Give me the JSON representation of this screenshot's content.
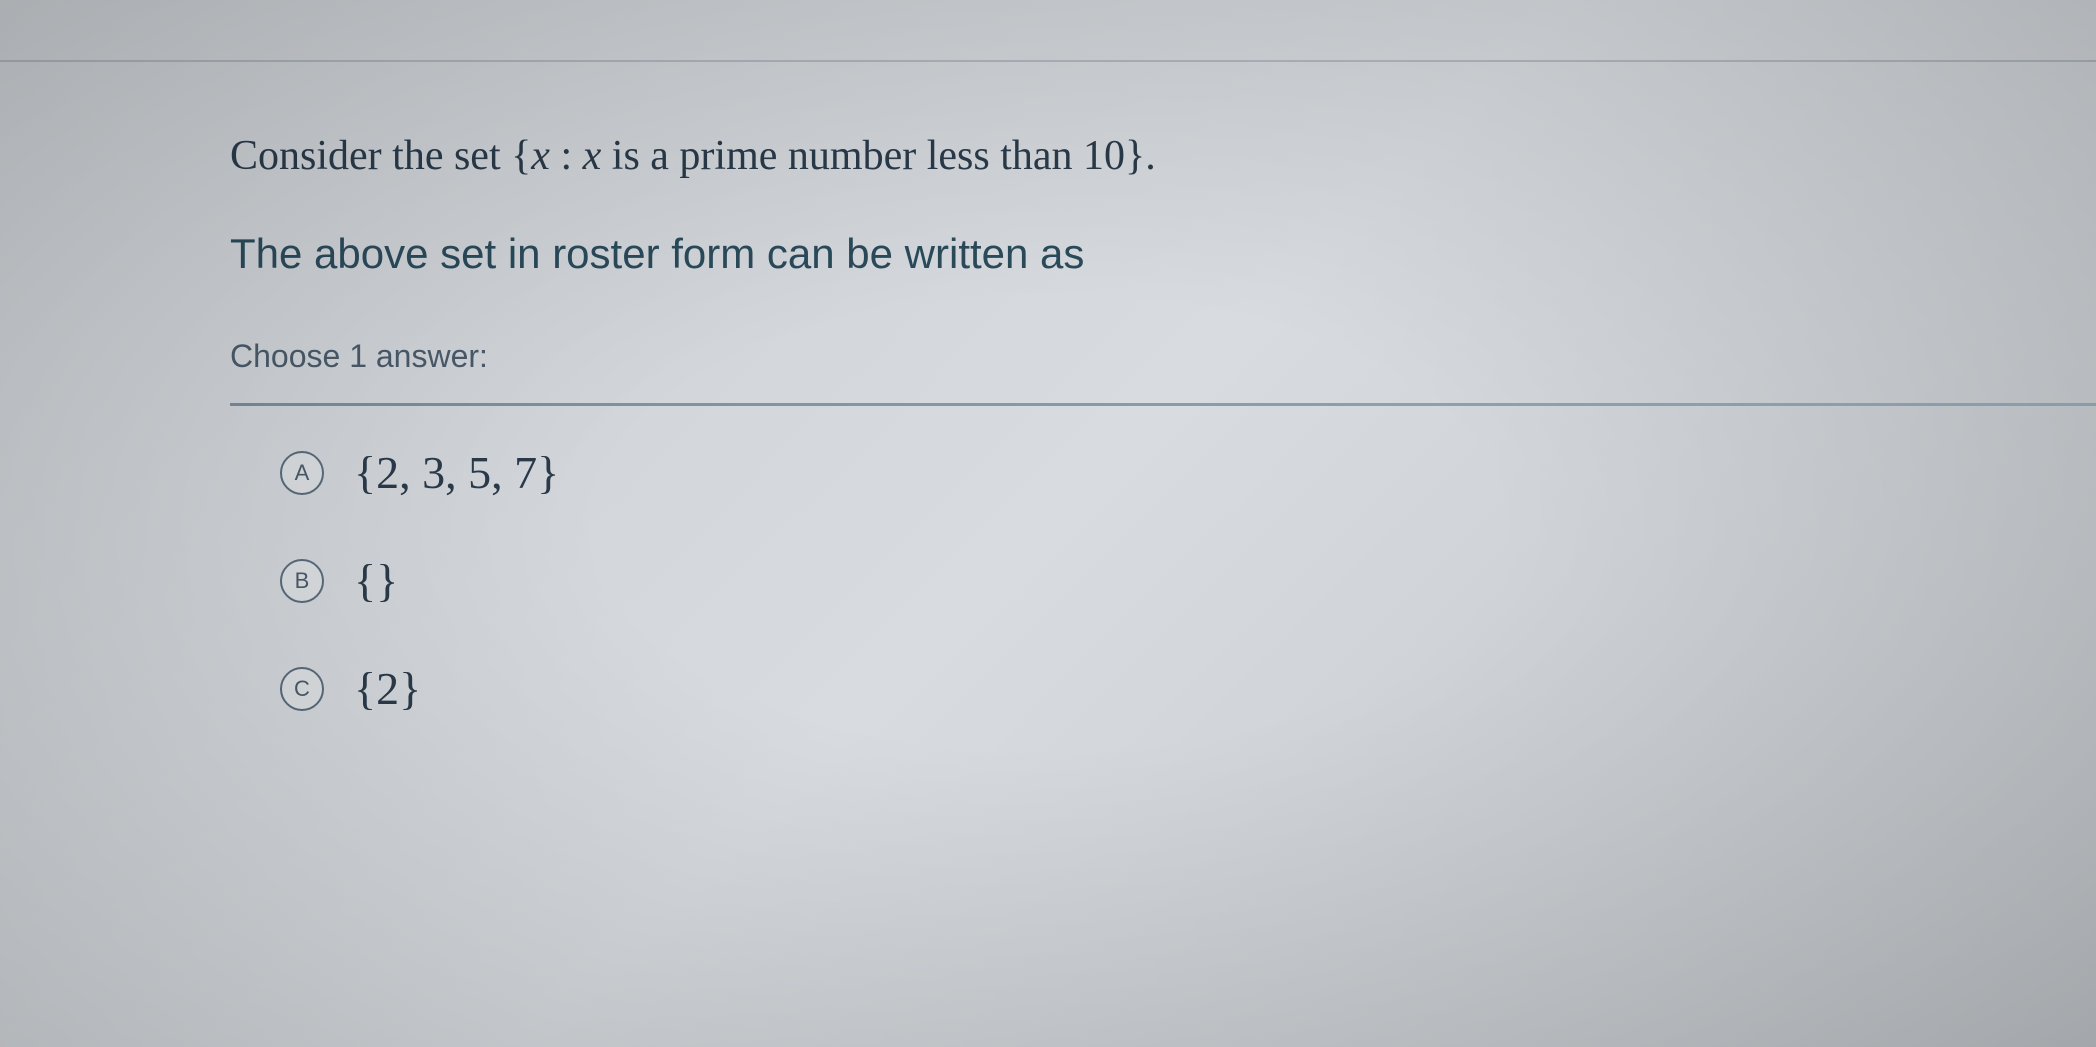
{
  "question": {
    "line1_prefix": "Consider the set ",
    "set_open": "{",
    "set_var": "x",
    "set_colon": " : ",
    "set_var2": "x",
    "set_desc": " is a prime number less than 10",
    "set_close": "}",
    "line1_suffix": ".",
    "line2": "The above set in roster form can be written as"
  },
  "choose_label": "Choose 1 answer:",
  "options": [
    {
      "letter": "A",
      "text": "{2, 3, 5, 7}"
    },
    {
      "letter": "B",
      "text": "{}"
    },
    {
      "letter": "C",
      "text": "{2}"
    }
  ]
}
